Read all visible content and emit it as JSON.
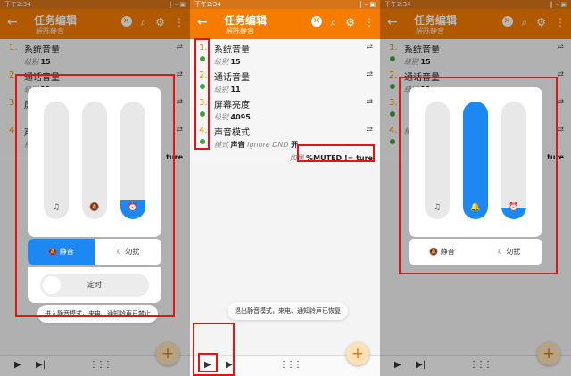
{
  "app": {
    "status_time": "下午2:34",
    "status_right": "‖ ⌁ ▣",
    "title": "任务编辑",
    "subtitle": "解除静音",
    "icons": [
      "back-arrow-icon",
      "clear-icon",
      "search-icon",
      "gear-icon",
      "more-icon"
    ]
  },
  "tasks": [
    {
      "num": "1.",
      "name": "系统音量",
      "detail_label": "级别",
      "detail_value": "15"
    },
    {
      "num": "2.",
      "name": "通话音量",
      "detail_label": "级别",
      "detail_value": "11"
    },
    {
      "num": "3.",
      "name": "屏幕亮度",
      "detail_label": "级别",
      "detail_value": "4095"
    },
    {
      "num": "4.",
      "name": "声音模式",
      "detail_label": "模式",
      "detail_value": "声音",
      "detail_extra": "Ignore DND",
      "detail_value2": "开"
    }
  ],
  "condition": {
    "label": "如果",
    "expr": "%MUTED != ture"
  },
  "partial": {
    "p1_t3_name": "屏",
    "p1_t4_name": "声",
    "p1_t4_detail": "模",
    "p1_cond_tail": "ture",
    "p3_t4_detail": "模",
    "p3_cond_tail": "ture"
  },
  "volume_popup_left": {
    "sliders": [
      {
        "icon": "music-note-icon",
        "glyph": "♫",
        "level": 0
      },
      {
        "icon": "bell-off-icon",
        "glyph": "🔕",
        "level": 0
      },
      {
        "icon": "alarm-icon",
        "glyph": "⏰",
        "level": 0.16
      }
    ],
    "modes": [
      {
        "label": "静音",
        "icon": "bell-off-icon",
        "active": true
      },
      {
        "label": "勿扰",
        "icon": "moon-icon",
        "active": false
      }
    ],
    "timer_label": "定时",
    "toast": "进入静音模式，来电、通知铃声已禁止"
  },
  "middle_toast": "退出静音模式，来电、通知铃声已恢复",
  "volume_popup_right": {
    "sliders": [
      {
        "icon": "music-note-icon",
        "glyph": "♫",
        "level": 0
      },
      {
        "icon": "bell-icon",
        "glyph": "🔔",
        "level": 1
      },
      {
        "icon": "alarm-icon",
        "glyph": "⏰",
        "level": 0.1
      }
    ],
    "modes": [
      {
        "label": "静音",
        "icon": "bell-off-icon",
        "active": false
      },
      {
        "label": "勿扰",
        "icon": "moon-icon",
        "active": false
      }
    ]
  },
  "bottom": {
    "play": "▶",
    "step": "▶|",
    "grid": "⋮⋮⋮",
    "fab": "+"
  },
  "colors": {
    "accent": "#f57c00",
    "blue": "#1e88f2",
    "highlight": "#e31414",
    "enabled": "#43a047"
  }
}
